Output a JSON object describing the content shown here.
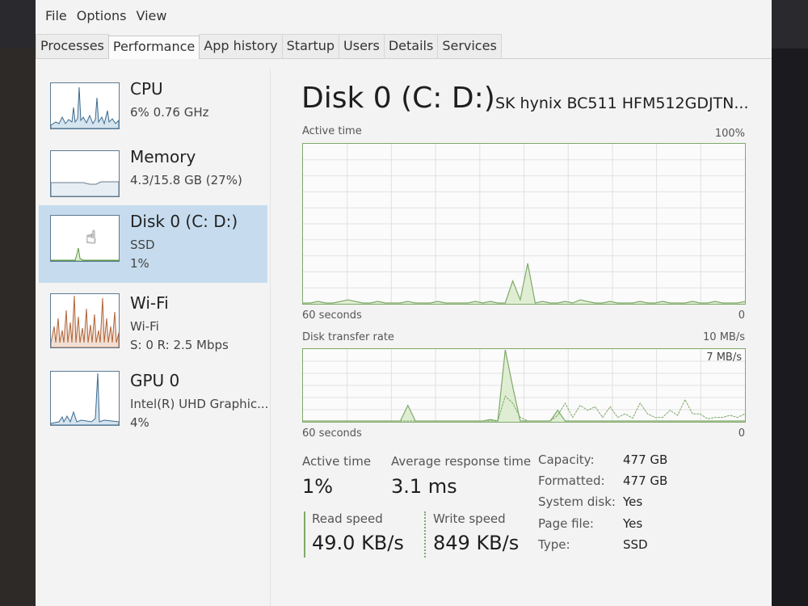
{
  "menu": [
    "File",
    "Options",
    "View"
  ],
  "tabs": [
    "Processes",
    "Performance",
    "App history",
    "Startup",
    "Users",
    "Details",
    "Services"
  ],
  "active_tab": "Performance",
  "sidebar": {
    "items": [
      {
        "title": "CPU",
        "sub1": "6% 0.76 GHz",
        "sub2": ""
      },
      {
        "title": "Memory",
        "sub1": "4.3/15.8 GB (27%)",
        "sub2": ""
      },
      {
        "title": "Disk 0 (C: D:)",
        "sub1": "SSD",
        "sub2": "1%"
      },
      {
        "title": "Wi-Fi",
        "sub1": "Wi-Fi",
        "sub2": "S: 0 R: 2.5 Mbps"
      },
      {
        "title": "GPU 0",
        "sub1": "Intel(R) UHD Graphic...",
        "sub2": "4%"
      }
    ],
    "selected_index": 2
  },
  "main": {
    "title": "Disk 0 (C: D:)",
    "model": "SK hynix BC511 HFM512GDJTN...",
    "active_graph": {
      "label": "Active time",
      "max": "100%",
      "xlabel": "60 seconds",
      "zero": "0"
    },
    "transfer_graph": {
      "label": "Disk transfer rate",
      "max": "10 MB/s",
      "secondary": "7 MB/s",
      "xlabel": "60 seconds",
      "zero": "0"
    },
    "stats": {
      "active_time_label": "Active time",
      "active_time_value": "1%",
      "avg_response_label": "Average response time",
      "avg_response_value": "3.1 ms",
      "read_label": "Read speed",
      "read_value": "49.0 KB/s",
      "write_label": "Write speed",
      "write_value": "849 KB/s"
    },
    "properties": [
      {
        "key": "Capacity:",
        "value": "477 GB"
      },
      {
        "key": "Formatted:",
        "value": "477 GB"
      },
      {
        "key": "System disk:",
        "value": "Yes"
      },
      {
        "key": "Page file:",
        "value": "Yes"
      },
      {
        "key": "Type:",
        "value": "SSD"
      }
    ]
  },
  "colors": {
    "graph_line": "#7fa96a",
    "graph_fill": "#dfeed3",
    "selection": "#c6dcee",
    "wifi_line": "#b0643a"
  },
  "chart_data": [
    {
      "type": "area",
      "title": "Active time",
      "xlabel": "60 seconds",
      "ylim": [
        0,
        100
      ],
      "values": [
        0,
        0,
        1,
        0,
        0,
        1,
        2,
        1,
        0,
        0,
        1,
        0,
        0,
        0,
        1,
        0,
        0,
        0,
        1,
        0,
        0,
        0,
        0,
        1,
        0,
        1,
        0,
        0,
        14,
        2,
        25,
        0,
        1,
        0,
        0,
        1,
        0,
        2,
        1,
        0,
        0,
        1,
        0,
        0,
        0,
        1,
        0,
        0,
        1,
        0,
        0,
        0,
        1,
        0,
        0,
        1,
        0,
        0,
        0,
        1
      ]
    },
    {
      "type": "line",
      "title": "Disk transfer rate",
      "xlabel": "60 seconds",
      "ylim": [
        0,
        10
      ],
      "series": [
        {
          "name": "Read speed",
          "values": [
            0,
            0,
            0,
            0,
            0,
            0,
            0,
            0,
            0,
            0,
            0,
            0,
            0,
            0,
            2.2,
            0,
            0,
            0,
            0,
            0,
            0,
            0,
            0,
            0,
            0,
            0.2,
            0,
            10,
            4.8,
            0,
            0,
            0,
            0,
            0,
            1.5,
            0,
            0,
            0,
            0,
            0,
            0,
            0,
            0,
            0,
            0,
            0,
            0,
            0,
            0,
            0,
            0,
            0,
            0,
            0,
            0,
            0,
            0,
            0,
            0,
            0
          ]
        },
        {
          "name": "Write speed",
          "values": [
            0,
            0,
            0,
            0,
            0,
            0,
            0,
            0,
            0,
            0,
            0,
            0,
            0,
            0,
            0,
            0,
            0,
            0,
            0,
            0,
            0,
            0,
            0,
            0,
            0,
            0,
            0,
            3.5,
            2.5,
            0.5,
            0,
            0,
            0,
            0,
            0.8,
            2.5,
            0.5,
            2.2,
            1.5,
            2.0,
            0.5,
            2.0,
            0.5,
            1.0,
            0.4,
            2.5,
            1.0,
            0.5,
            0.5,
            1.5,
            0.8,
            3.0,
            1.0,
            1.0,
            0.3,
            0.5,
            0.5,
            0.8,
            0.5,
            1.0
          ]
        }
      ]
    }
  ]
}
